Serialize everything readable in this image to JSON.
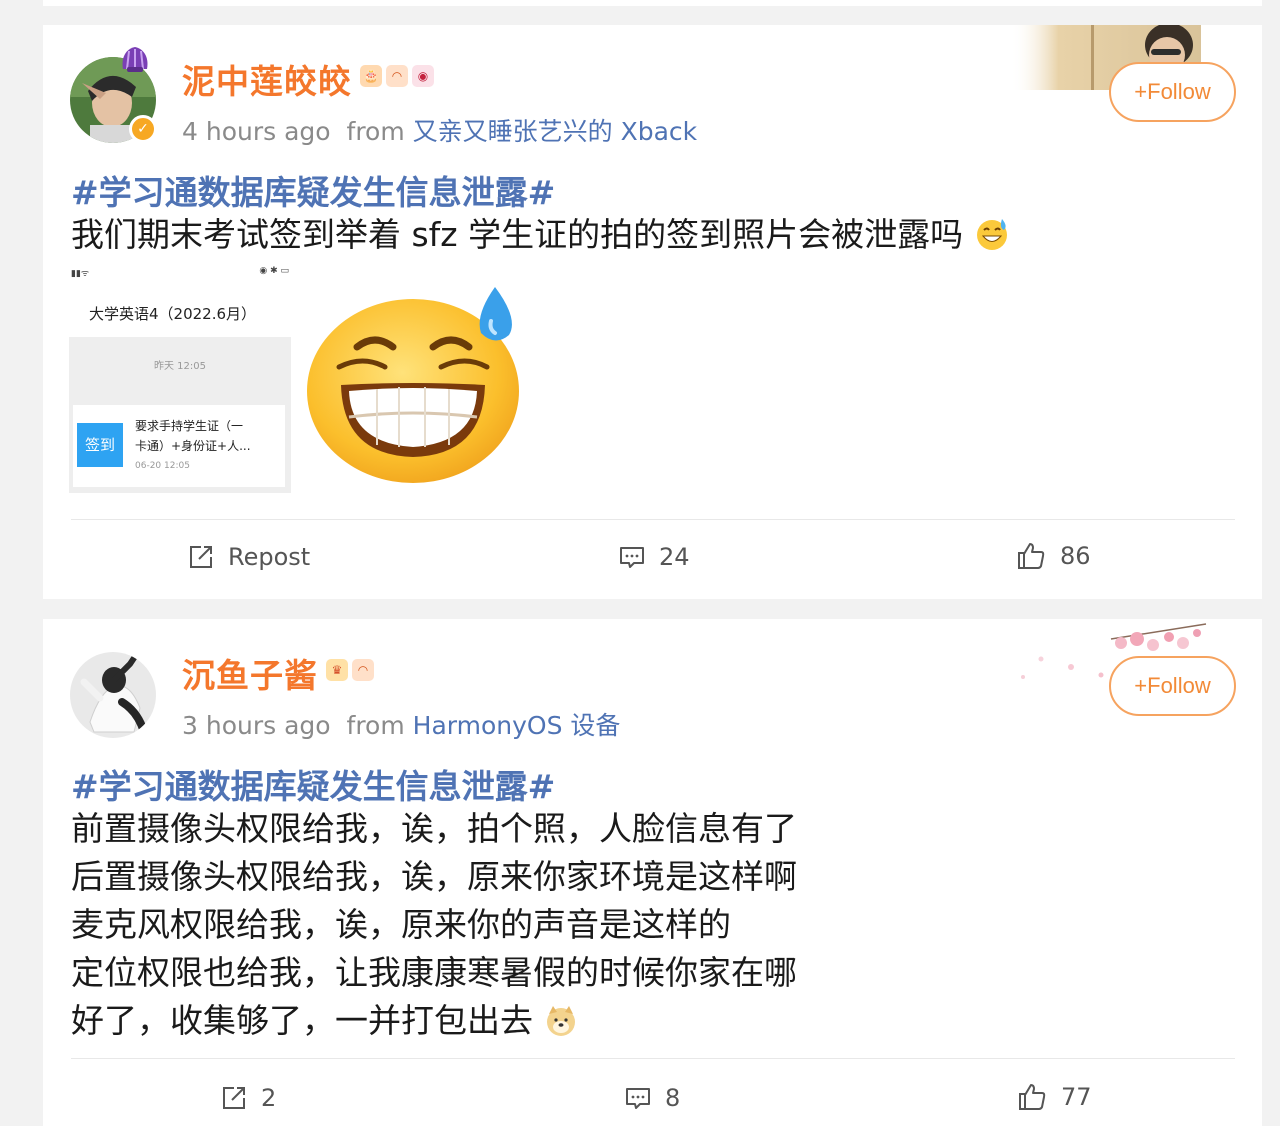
{
  "posts": [
    {
      "username": "泥中莲皎皎",
      "time": "4 hours ago",
      "from_label": "from",
      "source": "又亲又睡张艺兴的 Xback",
      "follow_label": "+Follow",
      "topic": "#学习通数据库疑发生信息泄露#",
      "text_lines": [
        "我们期末考试签到举着 sfz 学生证的拍的签到照片会被泄露吗"
      ],
      "embedded_screenshot": {
        "course": "大学英语4（2022.6月）",
        "timestamp": "昨天 12:05",
        "button": "签到",
        "message_line1": "要求手持学生证（一",
        "message_line2": "卡通）+身份证+人...",
        "date": "06-20 12:05"
      },
      "repost_label": "Repost",
      "comments": "24",
      "likes": "86"
    },
    {
      "username": "沉鱼子酱",
      "time": "3 hours ago",
      "from_label": "from",
      "source": "HarmonyOS 设备",
      "follow_label": "+Follow",
      "topic": "#学习通数据库疑发生信息泄露#",
      "text_lines": [
        "前置摄像头权限给我，诶，拍个照，人脸信息有了",
        "后置摄像头权限给我，诶，原来你家环境是这样啊",
        "麦克风权限给我，诶，原来你的声音是这样的",
        "定位权限也给我，让我康康寒暑假的时候你家在哪",
        "好了，收集够了，一并打包出去"
      ],
      "reposts": "2",
      "comments": "8",
      "likes": "77"
    }
  ],
  "icons": {
    "repost": "repost-icon",
    "comment": "comment-icon",
    "like": "thumbs-up-icon",
    "emoji_sweat": "grinning-sweat-emoji-icon",
    "emoji_doge": "doge-emoji-icon"
  },
  "colors": {
    "username": "#f4772c",
    "link": "#4f73b4",
    "follow": "#f28a37",
    "background": "#f2f2f2"
  }
}
